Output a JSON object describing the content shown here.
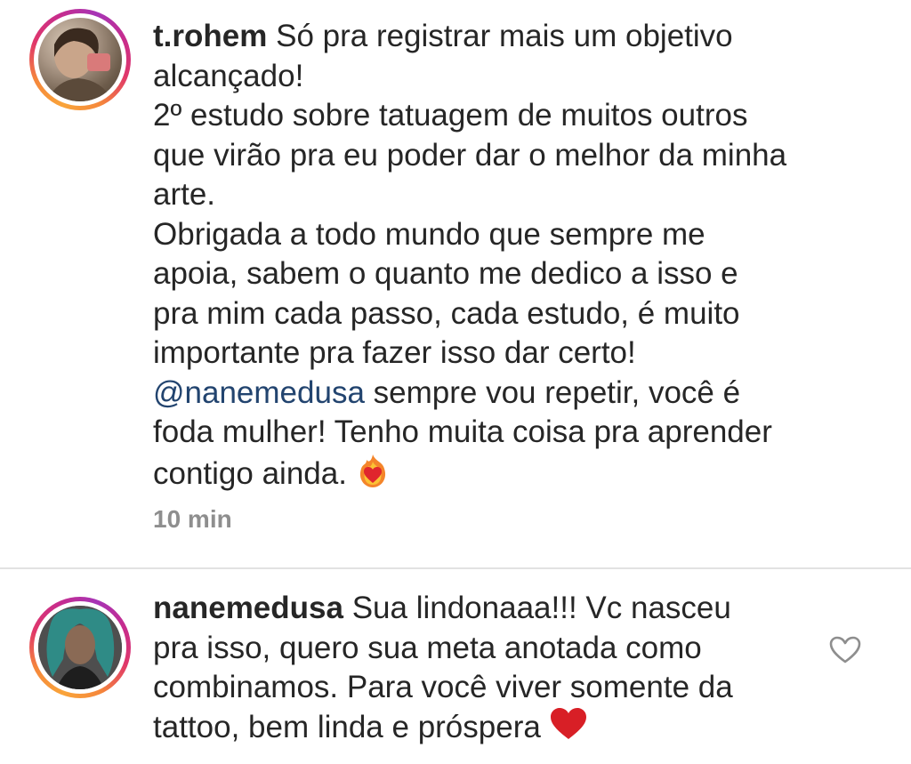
{
  "comments": [
    {
      "username": "t.rohem",
      "lines": [
        "Só pra registrar mais um objetivo",
        "alcançado!",
        "2º estudo sobre tatuagem de muitos outros",
        "que virão pra eu poder dar o melhor da minha",
        "arte.",
        "Obrigada a todo mundo que sempre me",
        "apoia, sabem o quanto me dedico a isso e",
        "pra mim cada passo, cada estudo, é muito",
        "importante pra fazer isso dar certo!"
      ],
      "mention": "@nanemedusa",
      "after_mention": "sempre vou repetir, você é",
      "lines_after": [
        "foda mulher! Tenho muita coisa pra aprender"
      ],
      "last_line": "contigo ainda.",
      "emoji_icon": "heart-on-fire-icon",
      "timestamp": "10 min"
    },
    {
      "username": "nanemedusa",
      "first_line": "Sua lindonaaa!!! Vc nasceu",
      "lines": [
        "pra isso, quero sua meta anotada como",
        "combinamos. Para você viver somente da"
      ],
      "last_line": "tattoo, bem linda e próspera",
      "emoji_icon": "red-heart-icon",
      "like_icon": "heart-outline-icon"
    }
  ],
  "colors": {
    "text": "#262626",
    "mention": "#22446f",
    "timestamp": "#8e8e8e",
    "heart_red": "#d81f26",
    "divider": "#e2e2e2"
  }
}
